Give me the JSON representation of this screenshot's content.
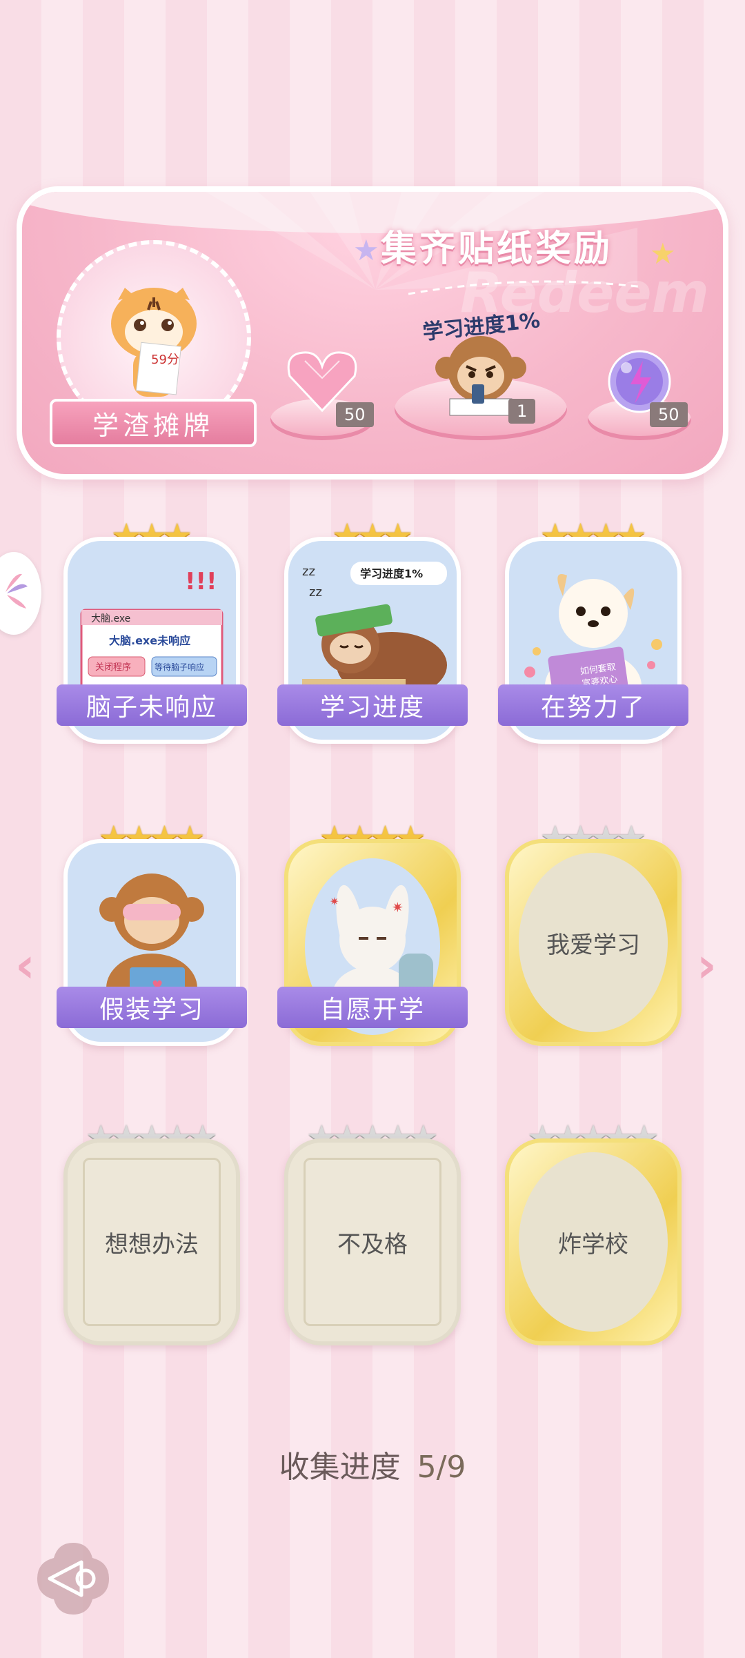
{
  "banner": {
    "title": "集齐贴纸奖励",
    "watermark": "Redeem",
    "profile_label": "学渣摊牌",
    "avatar_paper": "59分",
    "progress_caption": "学习进度1%",
    "rewards": [
      {
        "icon": "heart-gem-icon",
        "count": "50"
      },
      {
        "icon": "monkey-sticker-icon",
        "count": "1"
      },
      {
        "icon": "energy-orb-icon",
        "count": "50"
      }
    ]
  },
  "cards": [
    {
      "label": "脑子未响应",
      "stars": 3,
      "total_stars": 3,
      "unlocked": true,
      "style": "blue",
      "art": {
        "window_title": "大脑.exe",
        "message": "大脑.exe未响应",
        "btn1": "关闭程序",
        "btn2": "等待脑子响应"
      }
    },
    {
      "label": "学习进度",
      "stars": 3,
      "total_stars": 3,
      "unlocked": true,
      "style": "blue",
      "art": {
        "bubble": "学习进度1%",
        "zz": "zz"
      }
    },
    {
      "label": "在努力了",
      "stars": 4,
      "total_stars": 4,
      "unlocked": true,
      "style": "blue",
      "art": {
        "book": "如何套取富婆欢心"
      }
    },
    {
      "label": "假装学习",
      "stars": 4,
      "total_stars": 4,
      "unlocked": true,
      "style": "blue"
    },
    {
      "label": "自愿开学",
      "stars": 4,
      "total_stars": 4,
      "unlocked": true,
      "style": "gold"
    },
    {
      "label": "我爱学习",
      "stars": 0,
      "total_stars": 4,
      "unlocked": false,
      "style": "goldoval"
    },
    {
      "label": "想想办法",
      "stars": 0,
      "total_stars": 5,
      "unlocked": false,
      "style": "frame"
    },
    {
      "label": "不及格",
      "stars": 0,
      "total_stars": 5,
      "unlocked": false,
      "style": "frame"
    },
    {
      "label": "炸学校",
      "stars": 0,
      "total_stars": 5,
      "unlocked": false,
      "style": "goldoval"
    }
  ],
  "progress": {
    "label": "收集进度",
    "value": "5/9"
  },
  "colors": {
    "accent_purple": "#8b6bd6",
    "pink": "#f7b8cb",
    "gold_star": "#f5c542"
  }
}
